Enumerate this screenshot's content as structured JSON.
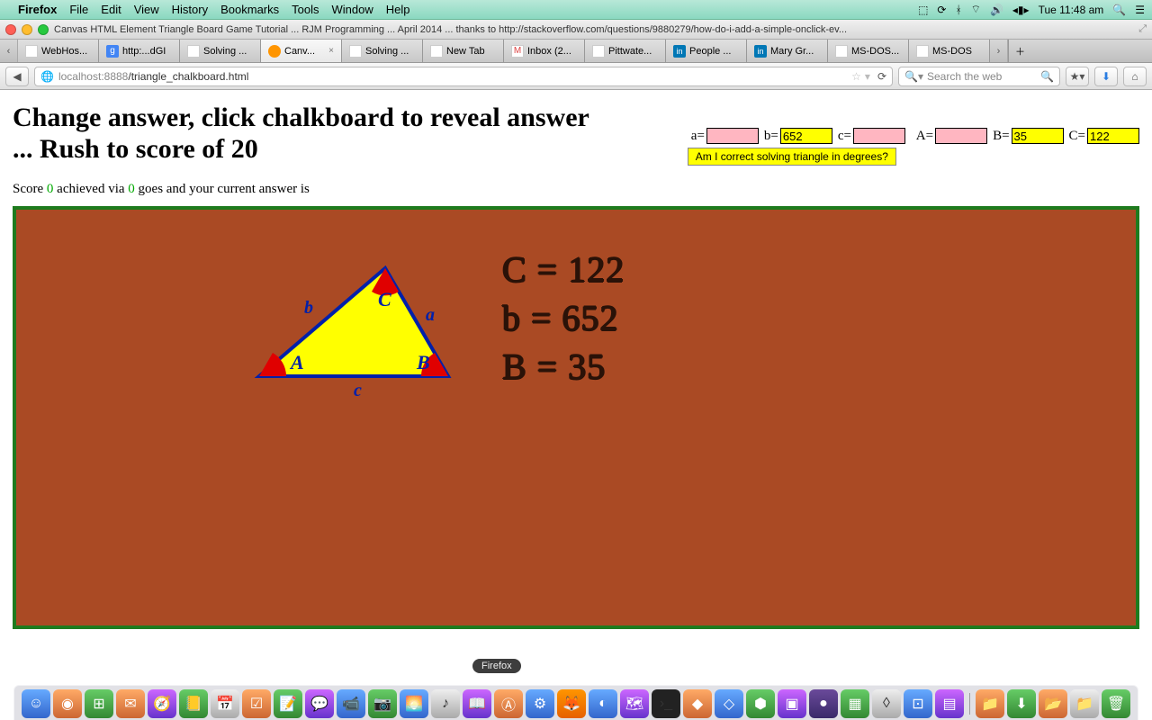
{
  "menubar": {
    "app": "Firefox",
    "items": [
      "File",
      "Edit",
      "View",
      "History",
      "Bookmarks",
      "Tools",
      "Window",
      "Help"
    ],
    "clock": "Tue 11:48 am"
  },
  "window": {
    "title": "Canvas HTML Element Triangle Board Game Tutorial ... RJM Programming ... April 2014 ... thanks to http://stackoverflow.com/questions/9880279/how-do-i-add-a-simple-onclick-ev..."
  },
  "tabs": [
    {
      "label": "WebHos..."
    },
    {
      "label": "http:...dGI"
    },
    {
      "label": "Solving ..."
    },
    {
      "label": "Canv...",
      "active": true
    },
    {
      "label": "Solving ..."
    },
    {
      "label": "New Tab"
    },
    {
      "label": "Inbox (2..."
    },
    {
      "label": "Pittwate..."
    },
    {
      "label": "People ..."
    },
    {
      "label": "Mary Gr..."
    },
    {
      "label": "MS-DOS..."
    },
    {
      "label": "MS-DOS"
    }
  ],
  "url": {
    "host": "localhost",
    "port": ":8888",
    "path": "/triangle_chalkboard.html"
  },
  "search": {
    "placeholder": "Search the web"
  },
  "page": {
    "heading": "Change answer, click chalkboard to reveal answer ... Rush to score of 20",
    "labels": {
      "a": "a=",
      "b": "b=",
      "c": "c=",
      "A": "A=",
      "B": "B=",
      "C": "C="
    },
    "values": {
      "a": "",
      "b": "652",
      "c": "",
      "A": "",
      "B": "35",
      "C": "122"
    },
    "button": "Am I correct solving triangle in degrees?",
    "score_pre": "Score ",
    "score": "0",
    "score_mid": " achieved via ",
    "goes": "0",
    "score_post": " goes and your current answer is"
  },
  "triangle": {
    "eq1": "C = 122",
    "eq2": "b = 652",
    "eq3": "B = 35",
    "A": "A",
    "B": "B",
    "C": "C",
    "sa": "a",
    "sb": "b",
    "sc": "c"
  },
  "dock_tooltip": "Firefox"
}
